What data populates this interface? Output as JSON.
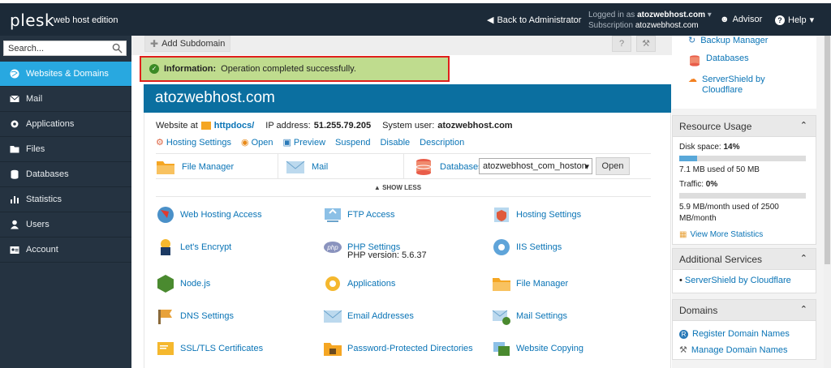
{
  "header": {
    "logo": "plesk",
    "edition": "web host edition",
    "back_label": "Back to Administrator",
    "logged_in_label": "Logged in as",
    "logged_in_user": "atozwebhost.com",
    "subscription_label": "Subscription",
    "subscription_value": "atozwebhost.com",
    "advisor_label": "Advisor",
    "help_label": "Help"
  },
  "sidebar": {
    "search_placeholder": "Search...",
    "items": [
      {
        "label": "Websites & Domains",
        "icon": "globe-icon"
      },
      {
        "label": "Mail",
        "icon": "envelope-icon"
      },
      {
        "label": "Applications",
        "icon": "gear-icon"
      },
      {
        "label": "Files",
        "icon": "folder-icon"
      },
      {
        "label": "Databases",
        "icon": "database-icon"
      },
      {
        "label": "Statistics",
        "icon": "bar-chart-icon"
      },
      {
        "label": "Users",
        "icon": "user-icon"
      },
      {
        "label": "Account",
        "icon": "account-card-icon"
      }
    ]
  },
  "main": {
    "add_subdomain": "Add Subdomain",
    "help_btn": "?",
    "info_title": "Information:",
    "info_text": "Operation completed successfully.",
    "domain": "atozwebhost.com",
    "website_at_label": "Website at",
    "website_at_value": "httpdocs/",
    "ip_label": "IP address:",
    "ip_value": "51.255.79.205",
    "sysuser_label": "System user:",
    "sysuser_value": "atozwebhost.com",
    "actions": [
      "Hosting Settings",
      "Open",
      "Preview",
      "Suspend",
      "Disable",
      "Description"
    ],
    "quick": {
      "file_manager": "File Manager",
      "mail": "Mail",
      "databases": "Databases",
      "db_selected": "atozwebhost_com_hoston",
      "open": "Open"
    },
    "show_less": "SHOW LESS",
    "tools": [
      {
        "label": "Web Hosting Access"
      },
      {
        "label": "FTP Access"
      },
      {
        "label": "Hosting Settings"
      },
      {
        "label": "Let's Encrypt"
      },
      {
        "label": "PHP Settings",
        "sub": "PHP version: 5.6.37"
      },
      {
        "label": "IIS Settings"
      },
      {
        "label": "Node.js"
      },
      {
        "label": "Applications"
      },
      {
        "label": "File Manager"
      },
      {
        "label": "DNS Settings"
      },
      {
        "label": "Email Addresses"
      },
      {
        "label": "Mail Settings"
      },
      {
        "label": "SSL/TLS Certificates"
      },
      {
        "label": "Password-Protected Directories"
      },
      {
        "label": "Website Copying"
      }
    ]
  },
  "right": {
    "backup": "Backup Manager",
    "databases": "Databases",
    "servershield": "ServerShield by Cloudflare",
    "resource_title": "Resource Usage",
    "disk_label": "Disk space:",
    "disk_pct": "14%",
    "disk_fraction": 0.14,
    "disk_detail": "7.1 MB used of 50 MB",
    "traffic_label": "Traffic:",
    "traffic_pct": "0%",
    "traffic_fraction": 0,
    "traffic_detail": "5.9 MB/month used of 2500 MB/month",
    "view_stats": "View More Statistics",
    "additional_title": "Additional Services",
    "additional_link": "ServerShield by Cloudflare",
    "domains_title": "Domains",
    "register": "Register Domain Names",
    "manage": "Manage Domain Names"
  }
}
